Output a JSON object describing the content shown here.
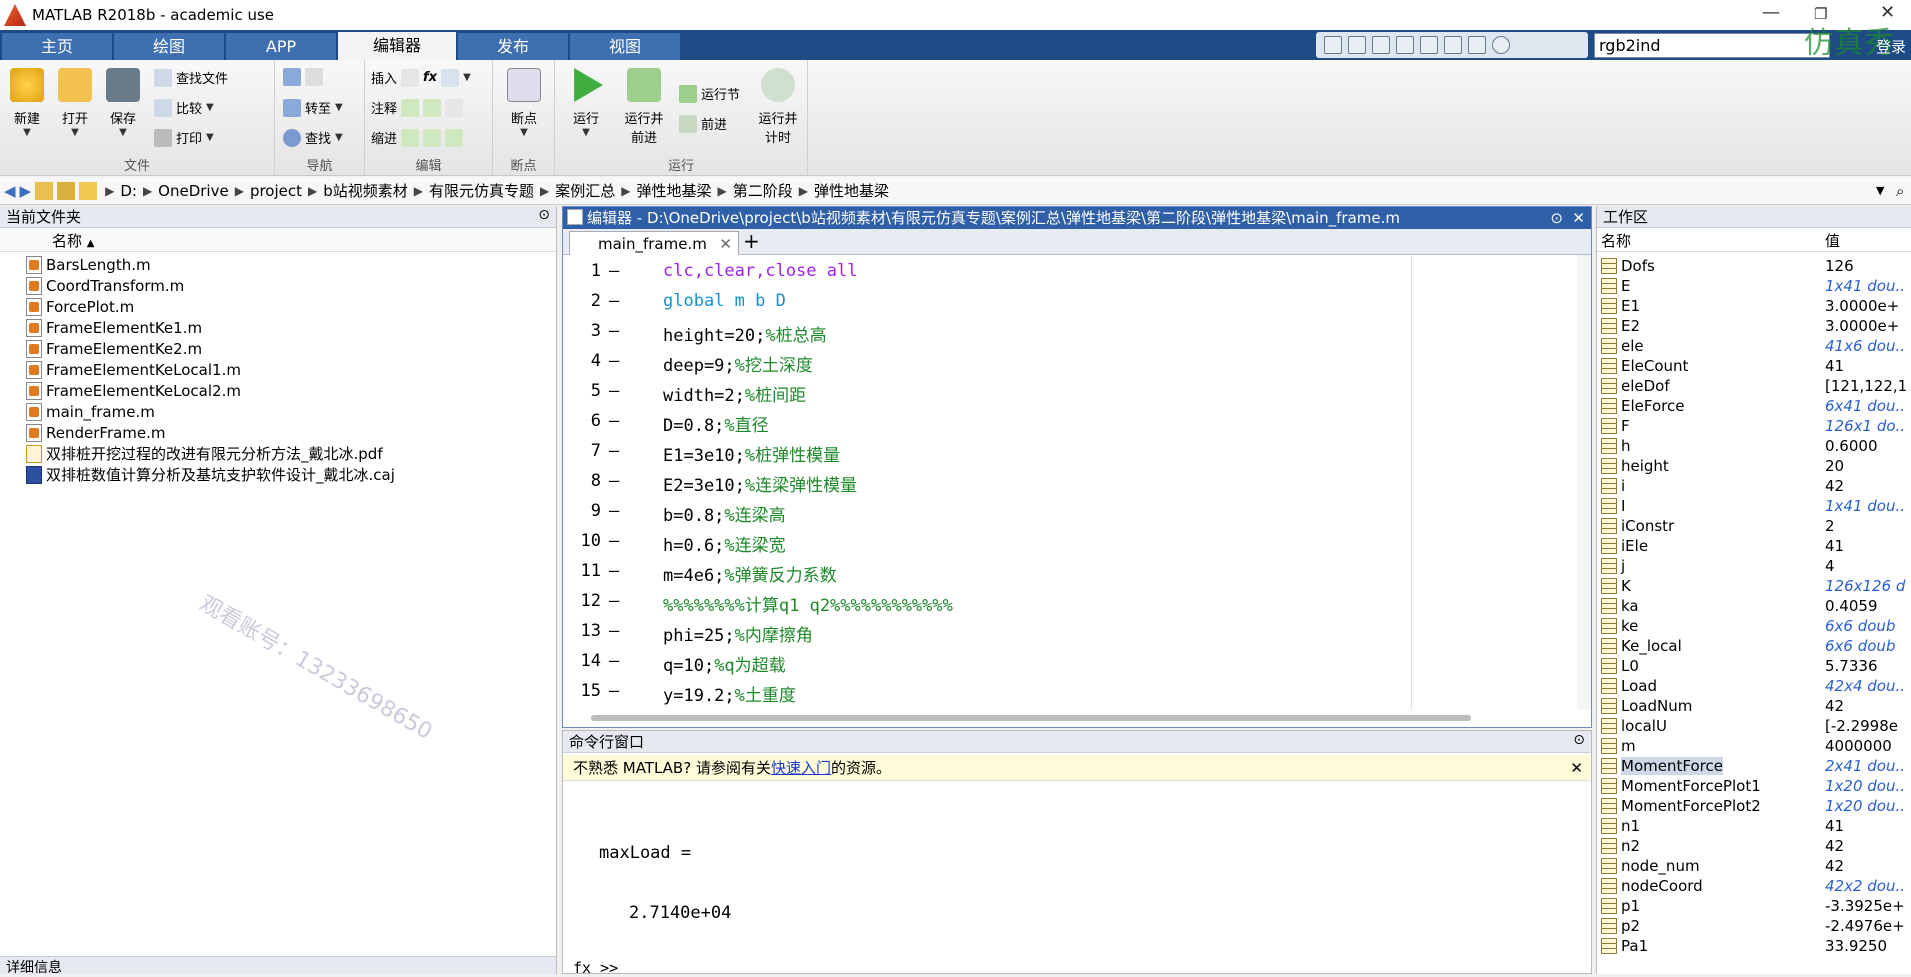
{
  "window": {
    "title": "MATLAB R2018b - academic use"
  },
  "tabs": [
    "主页",
    "绘图",
    "APP",
    "编辑器",
    "发布",
    "视图"
  ],
  "search": {
    "value": "rgb2ind",
    "login": "登录"
  },
  "corner_watermark": "仿真秀",
  "ribbon": {
    "file": {
      "label": "文件",
      "new": "新建",
      "open": "打开",
      "save": "保存",
      "find_files": "查找文件",
      "compare": "比较",
      "print": "打印"
    },
    "nav": {
      "label": "导航",
      "goto": "转至",
      "find": "查找"
    },
    "edit": {
      "label": "编辑",
      "insert": "插入",
      "comment": "注释",
      "indent": "缩进",
      "fx": "fx"
    },
    "breakpoints": {
      "label": "断点",
      "bp": "断点"
    },
    "run": {
      "label": "运行",
      "run": "运行",
      "run_advance": "运行并\n前进",
      "run_section": "运行节",
      "advance": "前进",
      "run_time": "运行并\n计时"
    }
  },
  "address": {
    "drive": "D:",
    "crumbs": [
      "OneDrive",
      "project",
      "b站视频素材",
      "有限元仿真专题",
      "案例汇总",
      "弹性地基梁",
      "第二阶段",
      "弹性地基梁"
    ]
  },
  "current_folder": {
    "title": "当前文件夹",
    "column": "名称",
    "files": [
      {
        "name": "BarsLength.m",
        "type": "m"
      },
      {
        "name": "CoordTransform.m",
        "type": "m"
      },
      {
        "name": "ForcePlot.m",
        "type": "m"
      },
      {
        "name": "FrameElementKe1.m",
        "type": "m"
      },
      {
        "name": "FrameElementKe2.m",
        "type": "m"
      },
      {
        "name": "FrameElementKeLocal1.m",
        "type": "m"
      },
      {
        "name": "FrameElementKeLocal2.m",
        "type": "m"
      },
      {
        "name": "main_frame.m",
        "type": "m"
      },
      {
        "name": "RenderFrame.m",
        "type": "m"
      },
      {
        "name": "双排桩开挖过程的改进有限元分析方法_戴北冰.pdf",
        "type": "pdf"
      },
      {
        "name": "双排桩数值计算分析及基坑支护软件设计_戴北冰.caj",
        "type": "caj"
      }
    ],
    "detail": "详细信息",
    "watermark": "观看账号：13233698650"
  },
  "editor": {
    "title": "编辑器 - D:\\OneDrive\\project\\b站视频素材\\有限元仿真专题\\案例汇总\\弹性地基梁\\第二阶段\\弹性地基梁\\main_frame.m",
    "tab": "main_frame.m",
    "lines": [
      {
        "n": "1",
        "code": "clc,clear,close ",
        "extra": "all",
        "cls": "pu",
        "cm": ""
      },
      {
        "n": "2",
        "code": "global m b D",
        "extra": "",
        "cls": "gl",
        "cm": ""
      },
      {
        "n": "3",
        "code": "height=20;",
        "extra": "",
        "cls": "",
        "cm": "%桩总高"
      },
      {
        "n": "4",
        "code": "deep=9;",
        "extra": "",
        "cls": "",
        "cm": "%挖土深度"
      },
      {
        "n": "5",
        "code": "width=2;",
        "extra": "",
        "cls": "",
        "cm": "%桩间距"
      },
      {
        "n": "6",
        "code": "D=0.8;",
        "extra": "",
        "cls": "",
        "cm": "%直径"
      },
      {
        "n": "7",
        "code": "E1=3e10;",
        "extra": "",
        "cls": "",
        "cm": "%桩弹性模量"
      },
      {
        "n": "8",
        "code": "E2=3e10;",
        "extra": "",
        "cls": "",
        "cm": "%连梁弹性模量"
      },
      {
        "n": "9",
        "code": "b=0.8;",
        "extra": "",
        "cls": "",
        "cm": "%连梁高"
      },
      {
        "n": "10",
        "code": "h=0.6;",
        "extra": "",
        "cls": "",
        "cm": "%连梁宽"
      },
      {
        "n": "11",
        "code": "m=4e6;",
        "extra": "",
        "cls": "",
        "cm": "%弹簧反力系数"
      },
      {
        "n": "12",
        "code": "",
        "extra": "",
        "cls": "",
        "cm": "%%%%%%%%计算q1 q2%%%%%%%%%%%%"
      },
      {
        "n": "13",
        "code": "phi=25;",
        "extra": "",
        "cls": "",
        "cm": "%内摩擦角"
      },
      {
        "n": "14",
        "code": "q=10;",
        "extra": "",
        "cls": "",
        "cm": "%q为超载"
      },
      {
        "n": "15",
        "code": "y=19.2;",
        "extra": "",
        "cls": "",
        "cm": "%土重度"
      }
    ]
  },
  "command": {
    "title": "命令行窗口",
    "info_pre": "不熟悉 MATLAB? 请参阅有关",
    "info_link": "快速入门",
    "info_post": "的资源。",
    "out1": "maxLoad =",
    "out2": "2.7140e+04",
    "prompt": "fx >>"
  },
  "workspace": {
    "title": "工作区",
    "col_name": "名称",
    "col_value": "值",
    "vars": [
      {
        "name": "Dofs",
        "value": "126",
        "it": false
      },
      {
        "name": "E",
        "value": "1x41 dou..",
        "it": true
      },
      {
        "name": "E1",
        "value": "3.0000e+",
        "it": false
      },
      {
        "name": "E2",
        "value": "3.0000e+",
        "it": false
      },
      {
        "name": "ele",
        "value": "41x6 dou..",
        "it": true
      },
      {
        "name": "EleCount",
        "value": "41",
        "it": false
      },
      {
        "name": "eleDof",
        "value": "[121,122,1",
        "it": false
      },
      {
        "name": "EleForce",
        "value": "6x41 dou..",
        "it": true
      },
      {
        "name": "F",
        "value": "126x1 do..",
        "it": true
      },
      {
        "name": "h",
        "value": "0.6000",
        "it": false
      },
      {
        "name": "height",
        "value": "20",
        "it": false
      },
      {
        "name": "i",
        "value": "42",
        "it": false
      },
      {
        "name": "I",
        "value": "1x41 dou..",
        "it": true
      },
      {
        "name": "iConstr",
        "value": "2",
        "it": false
      },
      {
        "name": "iEle",
        "value": "41",
        "it": false
      },
      {
        "name": "j",
        "value": "4",
        "it": false
      },
      {
        "name": "K",
        "value": "126x126 d",
        "it": true
      },
      {
        "name": "ka",
        "value": "0.4059",
        "it": false
      },
      {
        "name": "ke",
        "value": "6x6 doub",
        "it": true
      },
      {
        "name": "Ke_local",
        "value": "6x6 doub",
        "it": true
      },
      {
        "name": "L0",
        "value": "5.7336",
        "it": false
      },
      {
        "name": "Load",
        "value": "42x4 dou..",
        "it": true
      },
      {
        "name": "LoadNum",
        "value": "42",
        "it": false
      },
      {
        "name": "localU",
        "value": "[-2.2998e",
        "it": false
      },
      {
        "name": "m",
        "value": "4000000",
        "it": false
      },
      {
        "name": "MomentForce",
        "value": "2x41 dou..",
        "it": true
      },
      {
        "name": "MomentForcePlot1",
        "value": "1x20 dou..",
        "it": true
      },
      {
        "name": "MomentForcePlot2",
        "value": "1x20 dou..",
        "it": true
      },
      {
        "name": "n1",
        "value": "41",
        "it": false
      },
      {
        "name": "n2",
        "value": "42",
        "it": false
      },
      {
        "name": "node_num",
        "value": "42",
        "it": false
      },
      {
        "name": "nodeCoord",
        "value": "42x2 dou..",
        "it": true
      },
      {
        "name": "p1",
        "value": "-3.3925e+",
        "it": false
      },
      {
        "name": "p2",
        "value": "-2.4976e+",
        "it": false
      },
      {
        "name": "Pa1",
        "value": "33.9250",
        "it": false
      }
    ]
  }
}
